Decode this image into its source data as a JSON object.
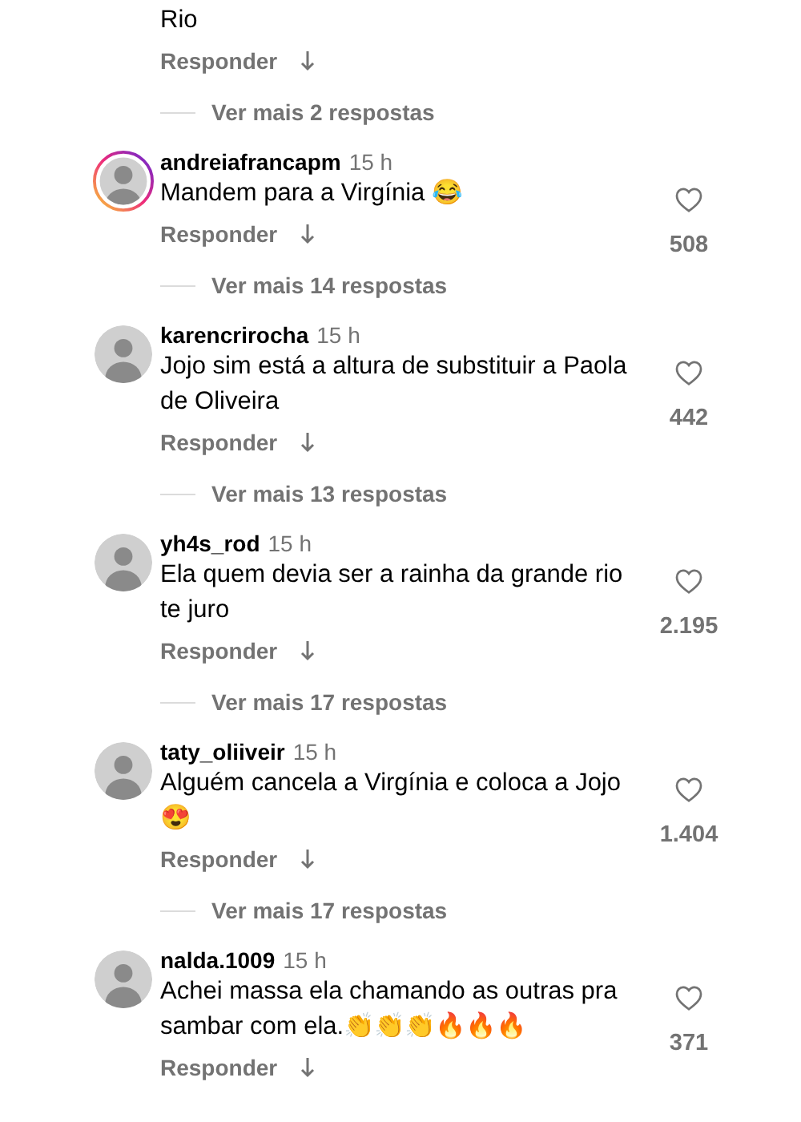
{
  "top_fragment": {
    "text": "Rio",
    "reply_label": "Responder",
    "more_replies": "Ver mais 2 respostas"
  },
  "comments": [
    {
      "username": "andreiafrancapm",
      "time": "15 h",
      "text": "Mandem para a Virgínia 😂",
      "likes": "508",
      "story_ring": true,
      "reply_label": "Responder",
      "more_replies": "Ver mais 14 respostas"
    },
    {
      "username": "karencrirocha",
      "time": "15 h",
      "text": "Jojo sim está a altura de substituir a Paola de Oliveira",
      "likes": "442",
      "story_ring": false,
      "reply_label": "Responder",
      "more_replies": "Ver mais 13 respostas"
    },
    {
      "username": "yh4s_rod",
      "time": "15 h",
      "text": "Ela quem devia ser a rainha da grande rio te juro",
      "likes": "2.195",
      "story_ring": false,
      "reply_label": "Responder",
      "more_replies": "Ver mais 17 respostas"
    },
    {
      "username": "taty_oliiveir",
      "time": "15 h",
      "text": "Alguém cancela a Virgínia e coloca a Jojo 😍",
      "likes": "1.404",
      "story_ring": false,
      "reply_label": "Responder",
      "more_replies": "Ver mais 17 respostas"
    },
    {
      "username": "nalda.1009",
      "time": "15 h",
      "text": "Achei massa ela chamando as outras pra sambar com ela.👏👏👏🔥🔥🔥",
      "likes": "371",
      "story_ring": false,
      "reply_label": "Responder"
    }
  ]
}
